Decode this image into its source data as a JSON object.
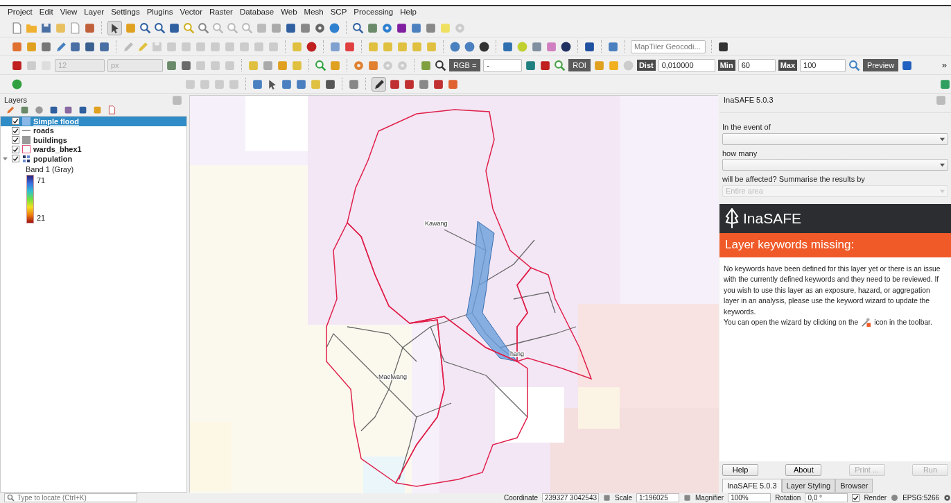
{
  "menu": [
    {
      "label": "Project"
    },
    {
      "label": "Edit"
    },
    {
      "label": "View"
    },
    {
      "label": "Layer"
    },
    {
      "label": "Settings"
    },
    {
      "label": "Plugins"
    },
    {
      "label": "Vector"
    },
    {
      "label": "Raster"
    },
    {
      "label": "Database"
    },
    {
      "label": "Web"
    },
    {
      "label": "Mesh"
    },
    {
      "label": "SCP"
    },
    {
      "label": "Processing"
    },
    {
      "label": "Help"
    }
  ],
  "toolbar_2": {
    "widgets": [
      {
        "kind": "field",
        "placeholder": "MapTiler Geocodi..."
      }
    ]
  },
  "toolbar_3": {
    "widgets": [
      {
        "kind": "spin",
        "value": "12",
        "disabled": true
      },
      {
        "kind": "combo",
        "value": "px",
        "disabled": true
      },
      {
        "kind": "dark-button",
        "label": "RGB ="
      },
      {
        "kind": "combo",
        "value": "-",
        "disabled": false
      },
      {
        "kind": "dark-button",
        "label": "ROI"
      },
      {
        "kind": "dark-label",
        "label": "Dist"
      },
      {
        "kind": "spin",
        "value": "0,010000",
        "disabled": false
      },
      {
        "kind": "dark-label",
        "label": "Min"
      },
      {
        "kind": "spin",
        "value": "60",
        "disabled": false
      },
      {
        "kind": "dark-label",
        "label": "Max"
      },
      {
        "kind": "spin",
        "value": "100",
        "disabled": false
      },
      {
        "kind": "dark-button",
        "label": "Preview"
      }
    ],
    "overflow": "»"
  },
  "layers_panel": {
    "title": "Layers",
    "items": [
      {
        "label": "Simple flood",
        "kind": "fill",
        "color": "#8ab8e8",
        "checked": true,
        "selected": true
      },
      {
        "label": "roads",
        "kind": "line",
        "color": "#808080",
        "checked": true,
        "selected": false
      },
      {
        "label": "buildings",
        "kind": "fill",
        "color": "#999999",
        "checked": true,
        "selected": false
      },
      {
        "label": "wards_bhex1",
        "kind": "outline",
        "color": "#e0507a",
        "checked": true,
        "selected": false
      },
      {
        "label": "population",
        "kind": "raster",
        "color": "#2a3a6a",
        "checked": true,
        "selected": false,
        "expanded": true,
        "children": [
          {
            "kind": "band",
            "label": "Band 1 (Gray)"
          },
          {
            "kind": "ramp",
            "max": "71",
            "min": "21"
          }
        ]
      }
    ]
  },
  "map": {
    "labels": [
      {
        "text": "Kawang"
      },
      {
        "text": "hang"
      },
      {
        "text": "Maelwang"
      }
    ]
  },
  "inasafe_panel": {
    "title": "InaSAFE 5.0.3",
    "fields": [
      {
        "label": "In the event of",
        "disabled": false
      },
      {
        "label": "how many",
        "disabled": false
      },
      {
        "label": "will be affected? Summarise the results by",
        "value": "Entire area",
        "disabled": true
      }
    ],
    "logo": "InaSAFE",
    "heading": "Layer keywords missing:",
    "message": "No keywords have been defined for this layer yet or there is an issue with the currently defined keywords and they need to be reviewed. If you wish to use this layer as an exposure, hazard, or aggregation layer in an analysis, please use the keyword wizard to update the keywords.",
    "message_line": "You can open the wizard by clicking on the",
    "message_end": "icon in the toolbar.",
    "buttons": [
      {
        "label": "Help",
        "disabled": false
      },
      {
        "label": "About",
        "disabled": false
      },
      {
        "label": "Print ...",
        "disabled": true
      },
      {
        "label": "Run",
        "disabled": true
      }
    ],
    "tabs": [
      {
        "label": "InaSAFE 5.0.3",
        "selected": true
      },
      {
        "label": "Layer Styling",
        "selected": false
      },
      {
        "label": "Browser",
        "selected": false
      }
    ]
  },
  "status_bar": {
    "locator": {
      "placeholder": "Type to locate (Ctrl+K)"
    },
    "coordinate": {
      "label": "Coordinate",
      "value": "239327 3042543"
    },
    "scale": {
      "label": "Scale",
      "value": "1:196025"
    },
    "magnifier": {
      "label": "Magnifier",
      "value": "100%"
    },
    "rotation": {
      "label": "Rotation",
      "value": "0,0 °"
    },
    "render": {
      "label": "Render",
      "checked": true
    },
    "crs": "EPSG:5266"
  }
}
